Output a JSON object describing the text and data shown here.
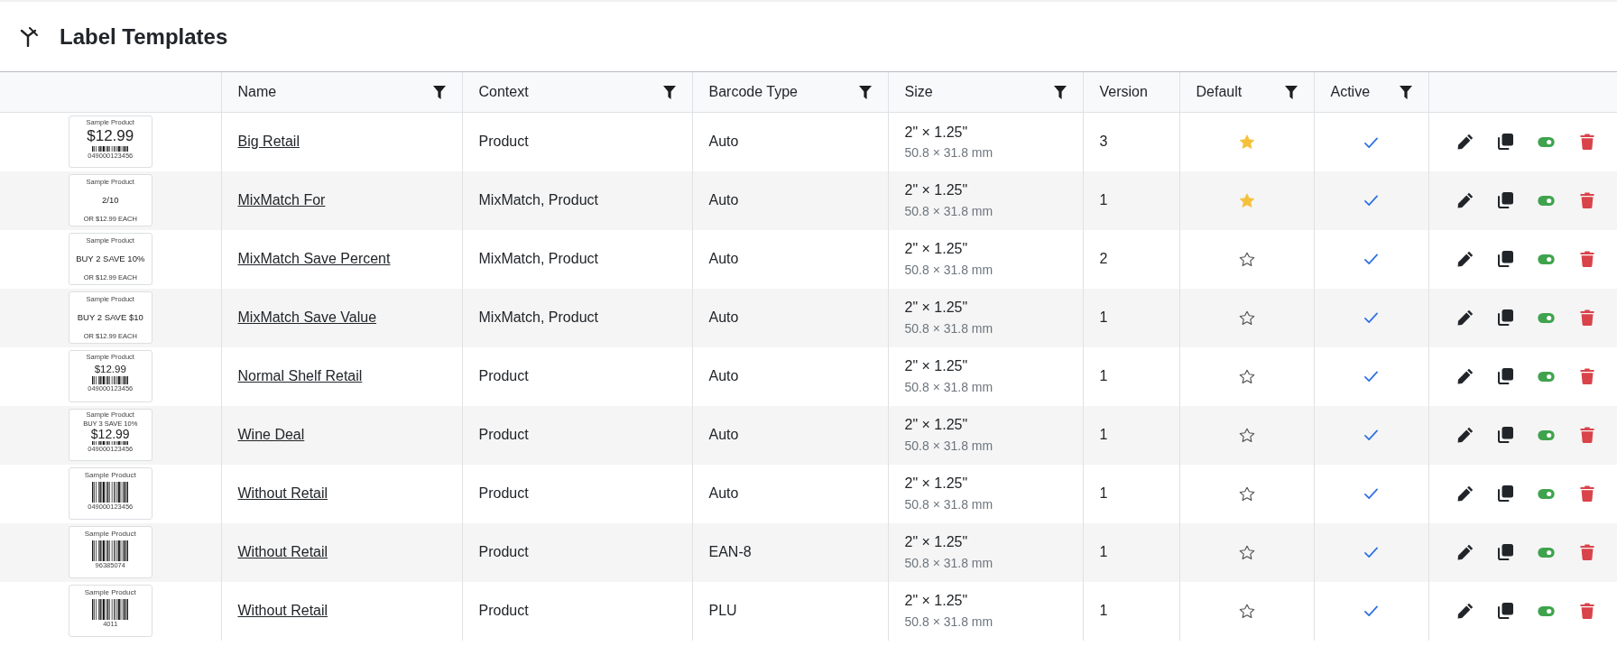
{
  "header": {
    "title": "Label Templates"
  },
  "table": {
    "columns": [
      {
        "label": "Name",
        "filter": true
      },
      {
        "label": "Context",
        "filter": true
      },
      {
        "label": "Barcode Type",
        "filter": true
      },
      {
        "label": "Size",
        "filter": true
      },
      {
        "label": "Version",
        "filter": false
      },
      {
        "label": "Default",
        "filter": true
      },
      {
        "label": "Active",
        "filter": true
      }
    ],
    "rows": [
      {
        "preview": {
          "kind": "retail",
          "title": "Sample Product",
          "price": "$12.99",
          "barcode": "049000123456"
        },
        "name": "Big Retail",
        "context": "Product",
        "barcode_type": "Auto",
        "size": "2\" × 1.25\"",
        "size_metric": "50.8 × 31.8 mm",
        "version": "3",
        "default": true,
        "active": true
      },
      {
        "preview": {
          "kind": "promo",
          "title": "Sample Product",
          "promo": "2/10",
          "note": "OR $12.99 EACH"
        },
        "name": "MixMatch For",
        "context": "MixMatch, Product",
        "barcode_type": "Auto",
        "size": "2\" × 1.25\"",
        "size_metric": "50.8 × 31.8 mm",
        "version": "1",
        "default": true,
        "active": true
      },
      {
        "preview": {
          "kind": "promo",
          "title": "Sample Product",
          "promo": "BUY 2 SAVE 10%",
          "note": "OR $12.99 EACH"
        },
        "name": "MixMatch Save Percent",
        "context": "MixMatch, Product",
        "barcode_type": "Auto",
        "size": "2\" × 1.25\"",
        "size_metric": "50.8 × 31.8 mm",
        "version": "2",
        "default": false,
        "active": true
      },
      {
        "preview": {
          "kind": "promo",
          "title": "Sample Product",
          "promo": "BUY 2 SAVE $10",
          "note": "OR $12.99 EACH"
        },
        "name": "MixMatch Save Value",
        "context": "MixMatch, Product",
        "barcode_type": "Auto",
        "size": "2\" × 1.25\"",
        "size_metric": "50.8 × 31.8 mm",
        "version": "1",
        "default": false,
        "active": true
      },
      {
        "preview": {
          "kind": "shelf",
          "title": "Sample Product",
          "price": "$12.99",
          "barcode": "049000123456"
        },
        "name": "Normal Shelf Retail",
        "context": "Product",
        "barcode_type": "Auto",
        "size": "2\" × 1.25\"",
        "size_metric": "50.8 × 31.8 mm",
        "version": "1",
        "default": false,
        "active": true
      },
      {
        "preview": {
          "kind": "deal",
          "title": "Sample Product",
          "promo": "BUY 3 SAVE 10%",
          "price": "$12.99",
          "barcode": "049000123456"
        },
        "name": "Wine Deal",
        "context": "Product",
        "barcode_type": "Auto",
        "size": "2\" × 1.25\"",
        "size_metric": "50.8 × 31.8 mm",
        "version": "1",
        "default": false,
        "active": true
      },
      {
        "preview": {
          "kind": "barcode",
          "title": "Sample Product",
          "barcode": "049000123456"
        },
        "name": "Without Retail",
        "context": "Product",
        "barcode_type": "Auto",
        "size": "2\" × 1.25\"",
        "size_metric": "50.8 × 31.8 mm",
        "version": "1",
        "default": false,
        "active": true
      },
      {
        "preview": {
          "kind": "barcode",
          "title": "Sample Product",
          "barcode": "96385074"
        },
        "name": "Without Retail",
        "context": "Product",
        "barcode_type": "EAN-8",
        "size": "2\" × 1.25\"",
        "size_metric": "50.8 × 31.8 mm",
        "version": "1",
        "default": false,
        "active": true
      },
      {
        "preview": {
          "kind": "barcode",
          "title": "Sample Product",
          "barcode": "4011"
        },
        "name": "Without Retail",
        "context": "Product",
        "barcode_type": "PLU",
        "size": "2\" × 1.25\"",
        "size_metric": "50.8 × 31.8 mm",
        "version": "1",
        "default": false,
        "active": true
      }
    ]
  }
}
